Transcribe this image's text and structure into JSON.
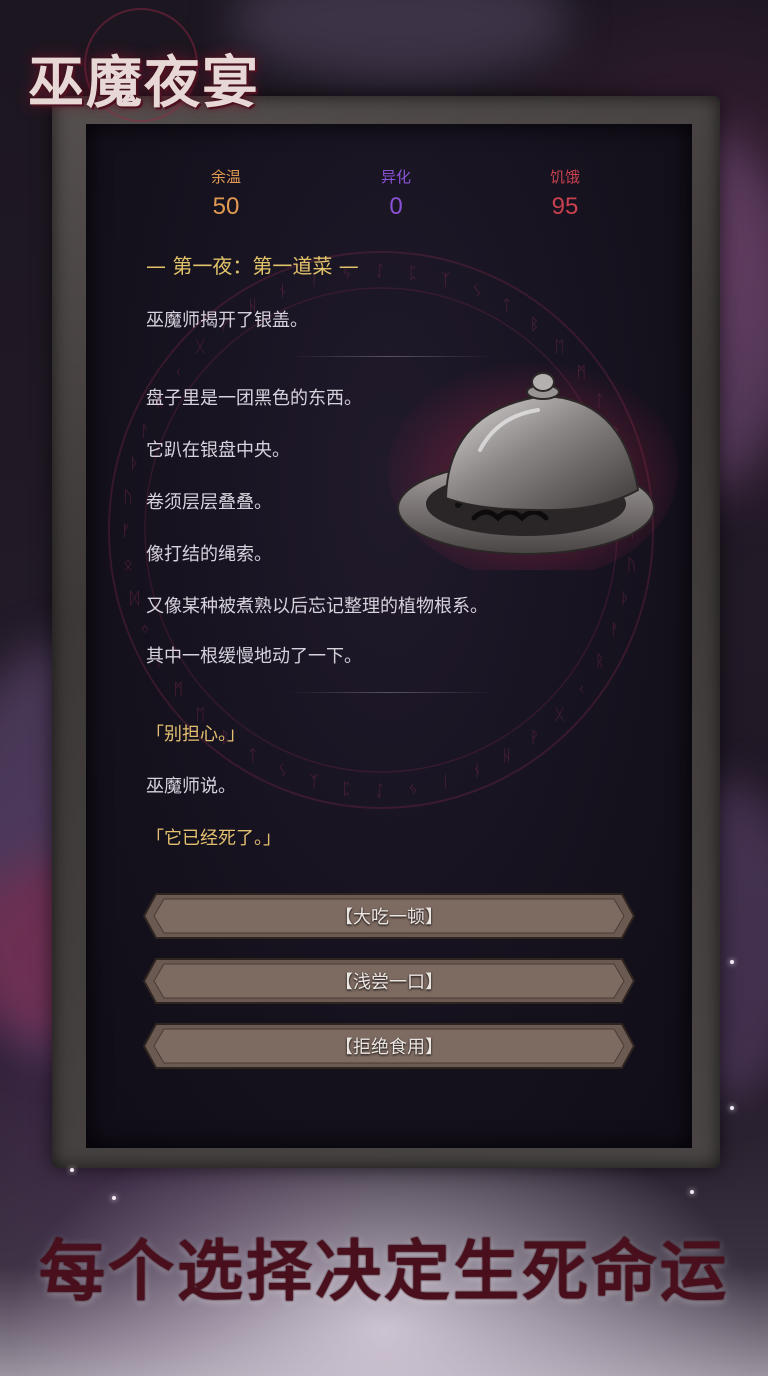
{
  "game": {
    "title": "巫魔夜宴"
  },
  "stats": [
    {
      "label": "余温",
      "value": "50",
      "color": "#e29a52"
    },
    {
      "label": "异化",
      "value": "0",
      "color": "#8a52d6"
    },
    {
      "label": "饥饿",
      "value": "95",
      "color": "#c9404f"
    }
  ],
  "story": {
    "chapter_title": "— 第一夜：第一道菜 —",
    "opening": "巫魔师揭开了银盖。",
    "paragraph": [
      "盘子里是一团黑色的东西。",
      "它趴在银盘中央。",
      "卷须层层叠叠。",
      "像打结的绳索。",
      "又像某种被煮熟以后忘记整理的植物根系。",
      "其中一根缓慢地动了一下。"
    ],
    "quote_1": "「别担心。」",
    "narration": "巫魔师说。",
    "quote_2": "「它已经死了。」"
  },
  "choices": [
    {
      "label": "【大吃一顿】"
    },
    {
      "label": "【浅尝一口】"
    },
    {
      "label": "【拒绝食用】"
    }
  ],
  "slogan": "每个选择决定生死命运",
  "icons": {
    "dish": "silver-cloche-dish-icon",
    "rune": "rune-circle-icon"
  },
  "colors": {
    "accent_gold": "#e2c36a",
    "slogan": "#4a0f1c"
  }
}
